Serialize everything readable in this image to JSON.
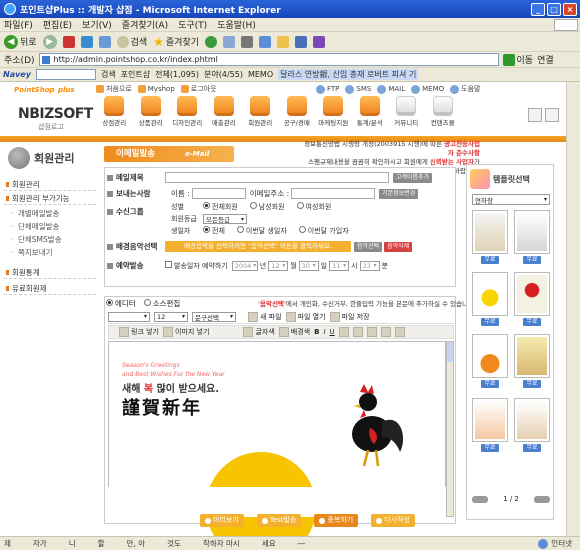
{
  "window": {
    "title": "포인트샵Plus :: 개발자 샵점 - Microsoft Internet Explorer",
    "btn_min": "_",
    "btn_max": "□",
    "btn_close": "×"
  },
  "menu": [
    "파일(F)",
    "편집(E)",
    "보기(V)",
    "즐겨찾기(A)",
    "도구(T)",
    "도움말(H)"
  ],
  "toolbar": {
    "back": "뒤로",
    "search": "검색",
    "favorites": "즐겨찾기"
  },
  "address": {
    "label": "주소(D)",
    "url": "http://admin.pointshop.co.kr/index.phtml",
    "go": "이동",
    "links": "연결"
  },
  "naveybar": {
    "brand": "Navey",
    "search_label": "검색",
    "item1": "포인트샵",
    "count": "전체(1,095)",
    "category": "분야(4/55)",
    "memo": "MEMO",
    "news": "달라스 연방銀, 신임 총재 로버트 피셔 기"
  },
  "site": {
    "logo_top": "PointShop",
    "logo_top_plus": "plus",
    "logo_main": "NBIZSOFT",
    "logo_sub": "샵점로고",
    "top_links": [
      "처음으로",
      "Myshop",
      "로그아웃"
    ],
    "right_links": [
      "FTP",
      "SMS",
      "MAIL",
      "MEMO",
      "도움말"
    ],
    "nav": [
      "상점관리",
      "상품관리",
      "디자인관리",
      "매출관리",
      "회원관리",
      "공구/경매",
      "마케팅지원",
      "통계/분석",
      "커뮤니티",
      "컨텐츠몰"
    ]
  },
  "sidebar": {
    "title": "회원관리",
    "items": [
      {
        "label": "회원관리",
        "type": "head"
      },
      {
        "label": "회원관리 부가기능",
        "type": "head"
      },
      {
        "label": "개별메일발송",
        "type": "sub"
      },
      {
        "label": "단체메일발송",
        "type": "sub"
      },
      {
        "label": "단체SMS발송",
        "type": "sub"
      },
      {
        "label": "쪽지보내기",
        "type": "sub"
      },
      {
        "label": "회원통계",
        "type": "head"
      },
      {
        "label": "유료회원제",
        "type": "head"
      }
    ]
  },
  "content": {
    "section_title": "이메일발송",
    "section_tag": "e-Mail",
    "notice_line1": "정보통신망법 시행령 개정(2003915 시행)에 따른 ",
    "notice_bold1": "광고전송사업자 준수사항",
    "notice_line2": "스팸규제내용을 꼼꼼히 확인하시고 회원에게 ",
    "notice_bold2": "신뢰받는 사업자",
    "notice_line3": "가 되시기 바랍니다.",
    "form": {
      "subject_label": "메일제목",
      "subject_btn": "고객이름추가",
      "sender_label": "보내는사람",
      "name_label": "이름 :",
      "email_label": "이메일주소 :",
      "default_btn": "기본정보변경",
      "recv_label": "수신그룹",
      "gender_label": "성별",
      "gender_opts": [
        "전체회원",
        "남성회원",
        "여성회원"
      ],
      "level_label": "회원등급",
      "level_value": "모든등급",
      "date_label": "생일자",
      "date_opts": [
        "전체",
        "이번달 생일자",
        "이번달 가입자"
      ],
      "bgm_label": "배경음악선택",
      "bgm_text": "배경음악을 선택하려면 \"음악선택\" 버튼을 클릭하세요.",
      "bgm_btn1": "음악선택",
      "bgm_btn2": "음악삭제",
      "reserve_label": "예약발송",
      "reserve_check": "발송일자 예약하기",
      "reserve_year": "2004",
      "reserve_year_u": "년",
      "reserve_month": "12",
      "reserve_month_u": "월",
      "reserve_day": "30",
      "reserve_day_u": "일",
      "reserve_hour": "11",
      "reserve_hour_u": "시",
      "reserve_min": "23",
      "reserve_min_u": "분"
    },
    "editor": {
      "mode_editor": "에디터",
      "mode_source": "소스편집",
      "note_bold": "'음악선택'",
      "note": "에서 개인화, 수신거부, 한줄입력 기능을 본문에 추가하실 수 있습니다.",
      "font_size": "12",
      "font_name": "문구선택",
      "new_file": "새 파일",
      "open_file": "파일 열기",
      "save_file": "파일 저장",
      "link": "링크 넣기",
      "image": "이미지 넣기",
      "fontcolor": "글자색",
      "bgcolor": "배경색",
      "card_en1": "Season's Greetings",
      "card_en2": "and Best Wishes For the New Year",
      "card_ko_pre": "새해 ",
      "card_ko_mid": "복",
      "card_ko_post": " 많이 받으세요.",
      "card_hanja": "謹賀新年"
    },
    "bottom_buttons": [
      "미리보기",
      "Test발송",
      "중복하기",
      "다시작성"
    ]
  },
  "template_panel": {
    "title": "템플릿선택",
    "select": "연하장",
    "free": "무료",
    "page": "1 / 2",
    "prev": "PREV",
    "next": "NEXT"
  },
  "status": [
    "제",
    "자가",
    "니",
    "할",
    "만, 아",
    "것도",
    "착하자 마시",
    "세요",
    "―"
  ],
  "status_zone": "인터넷"
}
